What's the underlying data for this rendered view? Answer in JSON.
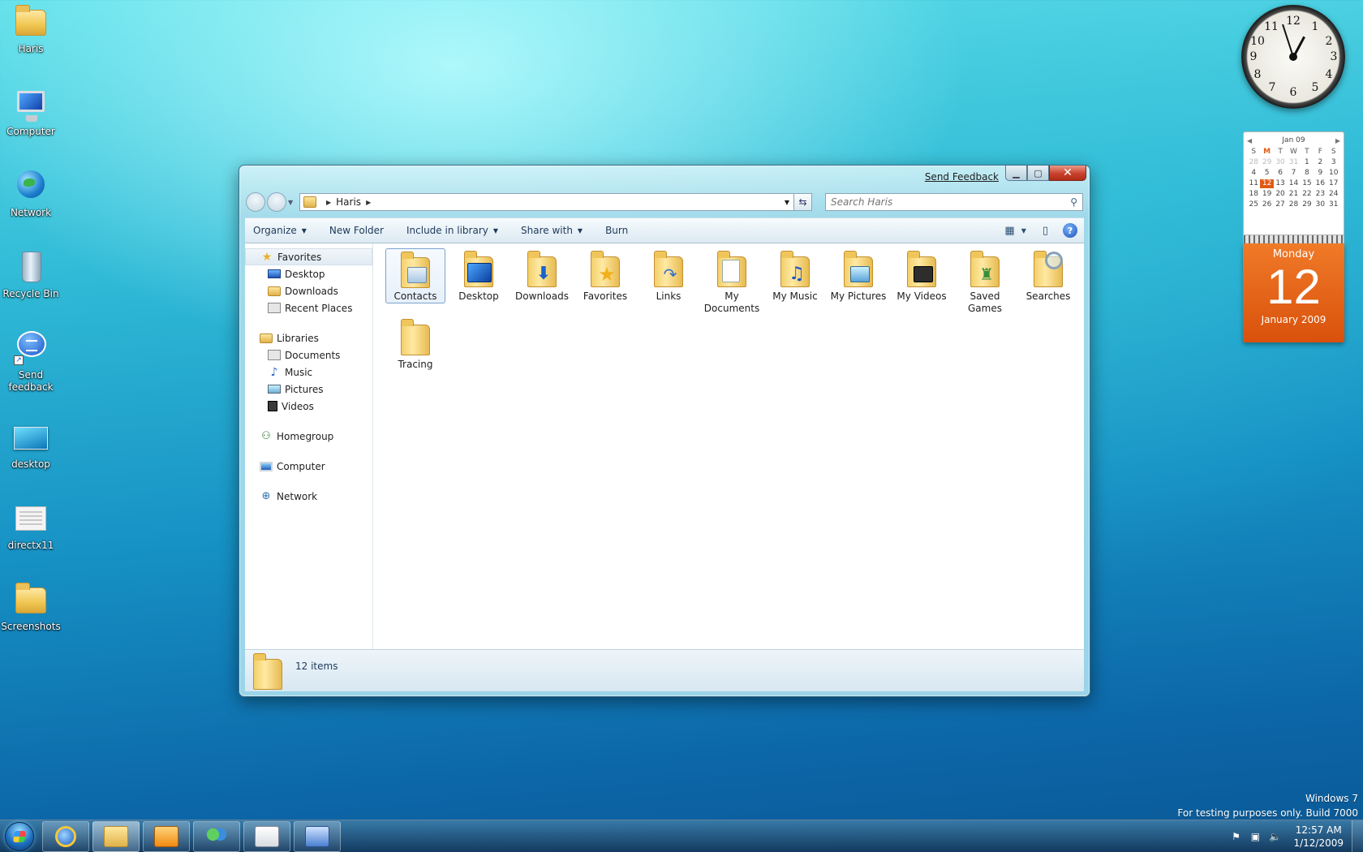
{
  "desktop": {
    "icons": [
      {
        "label": "Haris"
      },
      {
        "label": "Computer"
      },
      {
        "label": "Network"
      },
      {
        "label": "Recycle Bin"
      },
      {
        "label": "Send feedback"
      },
      {
        "label": "desktop"
      },
      {
        "label": "directx11"
      },
      {
        "label": "Screenshots"
      }
    ]
  },
  "window": {
    "send_feedback": "Send Feedback",
    "address": {
      "segment": "Haris"
    },
    "search": {
      "placeholder": "Search Haris"
    },
    "toolbar": {
      "organize": "Organize",
      "new_folder": "New Folder",
      "include_in_library": "Include in library",
      "share_with": "Share with",
      "burn": "Burn"
    },
    "nav": {
      "favorites": {
        "label": "Favorites",
        "items": [
          "Desktop",
          "Downloads",
          "Recent Places"
        ]
      },
      "libraries": {
        "label": "Libraries",
        "items": [
          "Documents",
          "Music",
          "Pictures",
          "Videos"
        ]
      },
      "homegroup": "Homegroup",
      "computer": "Computer",
      "network": "Network"
    },
    "files": [
      {
        "name": "Contacts",
        "icon": "contacts-folder-icon"
      },
      {
        "name": "Desktop",
        "icon": "desktop-folder-icon"
      },
      {
        "name": "Downloads",
        "icon": "downloads-folder-icon"
      },
      {
        "name": "Favorites",
        "icon": "favorites-folder-icon"
      },
      {
        "name": "Links",
        "icon": "links-folder-icon"
      },
      {
        "name": "My Documents",
        "icon": "documents-folder-icon"
      },
      {
        "name": "My Music",
        "icon": "music-folder-icon"
      },
      {
        "name": "My Pictures",
        "icon": "pictures-folder-icon"
      },
      {
        "name": "My Videos",
        "icon": "videos-folder-icon"
      },
      {
        "name": "Saved Games",
        "icon": "games-folder-icon"
      },
      {
        "name": "Searches",
        "icon": "searches-folder-icon"
      },
      {
        "name": "Tracing",
        "icon": "folder-icon"
      }
    ],
    "status": {
      "item_count": "12 items"
    }
  },
  "gadgets": {
    "calendar": {
      "month_header": "Jan 09",
      "weekdays": [
        "S",
        "M",
        "T",
        "W",
        "T",
        "F",
        "S"
      ],
      "weeks": [
        [
          "28",
          "29",
          "30",
          "31",
          "1",
          "2",
          "3"
        ],
        [
          "4",
          "5",
          "6",
          "7",
          "8",
          "9",
          "10"
        ],
        [
          "11",
          "12",
          "13",
          "14",
          "15",
          "16",
          "17"
        ],
        [
          "18",
          "19",
          "20",
          "21",
          "22",
          "23",
          "24"
        ],
        [
          "25",
          "26",
          "27",
          "28",
          "29",
          "30",
          "31"
        ]
      ],
      "weekday_name": "Monday",
      "day_number": "12",
      "month_year": "January 2009"
    },
    "clock": {
      "numbers": [
        "12",
        "1",
        "2",
        "3",
        "4",
        "5",
        "6",
        "7",
        "8",
        "9",
        "10",
        "11"
      ]
    }
  },
  "watermark": {
    "line1": "Windows 7",
    "line2": "For testing purposes only. Build 7000"
  },
  "taskbar": {
    "time": "12:57 AM",
    "date": "1/12/2009"
  },
  "colors": {
    "calendar_accent": "#e05a14",
    "toolbar_text": "#1e395b"
  }
}
